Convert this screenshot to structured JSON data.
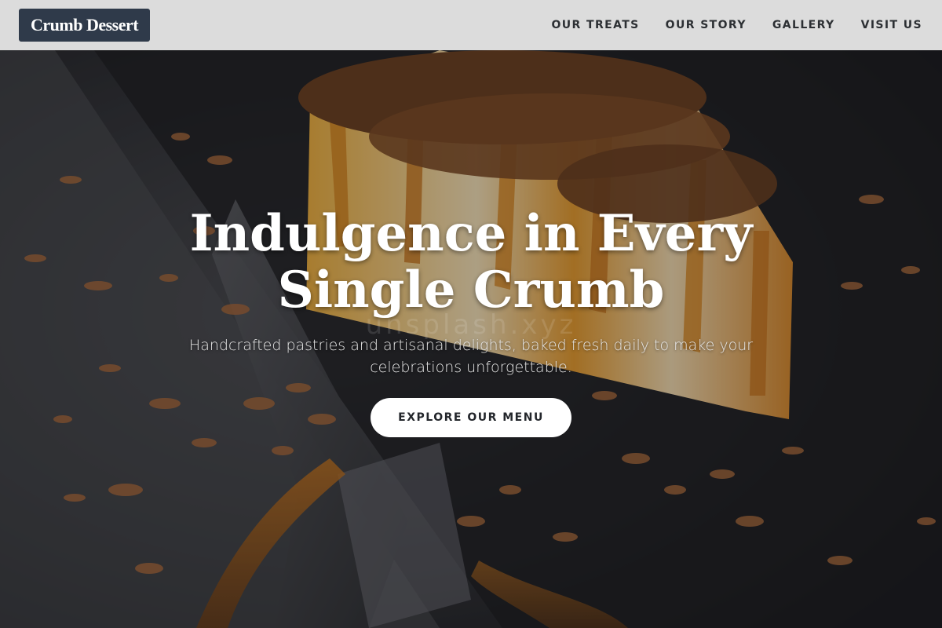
{
  "brand": {
    "logo_text": "Crumb Dessert"
  },
  "nav": {
    "items": [
      {
        "label": "OUR TREATS"
      },
      {
        "label": "OUR STORY"
      },
      {
        "label": "GALLERY"
      },
      {
        "label": "VISIT US"
      }
    ]
  },
  "hero": {
    "title_line1": "Indulgence in Every",
    "title_line2": "Single Crumb",
    "subtitle": "Handcrafted pastries and artisanal delights, baked fresh daily to make your celebrations unforgettable.",
    "cta_label": "EXPLORE OUR MENU",
    "background_image": "cheesecake-with-chocolate-shavings-photo"
  },
  "colors": {
    "header_bg": "#dcdcdc",
    "logo_bg": "#2f3a4a",
    "nav_text": "#2c2f33",
    "cta_bg": "#ffffff",
    "cta_text": "#23262b"
  }
}
